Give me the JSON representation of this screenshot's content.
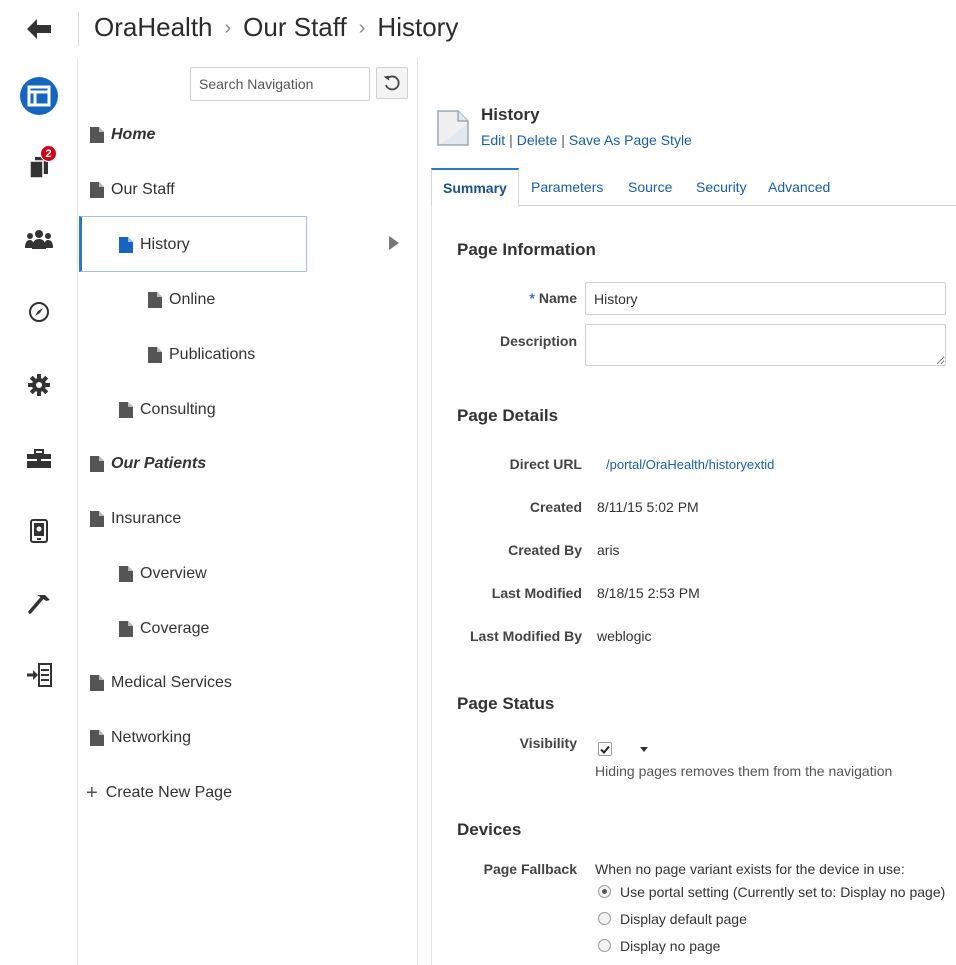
{
  "breadcrumb": {
    "items": [
      "OraHealth",
      "Our Staff",
      "History"
    ],
    "separator": "›"
  },
  "rail": {
    "icons": [
      "layout-icon",
      "pages-icon",
      "people-icon",
      "compass-icon",
      "gear-icon",
      "toolbox-icon",
      "device-icon",
      "hammer-icon",
      "import-icon"
    ],
    "badge_count": "2",
    "accent_color": "#1565c0"
  },
  "nav": {
    "search_placeholder": "Search Navigation",
    "items": [
      {
        "label": "Home"
      },
      {
        "label": "Our Staff"
      },
      {
        "label": "History"
      },
      {
        "label": "Online"
      },
      {
        "label": "Publications"
      },
      {
        "label": "Consulting"
      },
      {
        "label": "Our Patients"
      },
      {
        "label": "Insurance"
      },
      {
        "label": "Overview"
      },
      {
        "label": "Coverage"
      },
      {
        "label": "Medical Services"
      },
      {
        "label": "Networking"
      }
    ],
    "create_label": "Create New Page"
  },
  "page": {
    "title": "History",
    "links": {
      "edit": "Edit",
      "delete": "Delete",
      "save_style": "Save As Page Style"
    }
  },
  "tabs": [
    "Summary",
    "Parameters",
    "Source",
    "Security",
    "Advanced"
  ],
  "info": {
    "heading": "Page Information",
    "name_label": "Name",
    "required_mark": "*",
    "name_value": "History",
    "description_label": "Description",
    "description_value": ""
  },
  "details": {
    "heading": "Page Details",
    "rows": [
      {
        "label": "Direct URL",
        "value": "/portal/OraHealth/historyextid"
      },
      {
        "label": "Created",
        "value": "8/11/15 5:02 PM"
      },
      {
        "label": "Created By",
        "value": "aris"
      },
      {
        "label": "Last Modified",
        "value": "8/18/15 2:53 PM"
      },
      {
        "label": "Last Modified By",
        "value": "weblogic"
      }
    ]
  },
  "status": {
    "heading": "Page Status",
    "visibility_label": "Visibility",
    "visibility_checked": true,
    "hint": "Hiding pages removes them from the navigation"
  },
  "devices": {
    "heading": "Devices",
    "fallback_label": "Page Fallback",
    "fallback_text": "When no page variant exists for the device in use:",
    "options": [
      {
        "label": "Use portal setting (Currently set to: Display no page)",
        "selected": true
      },
      {
        "label": "Display default page",
        "selected": false
      },
      {
        "label": "Display no page",
        "selected": false
      }
    ]
  }
}
